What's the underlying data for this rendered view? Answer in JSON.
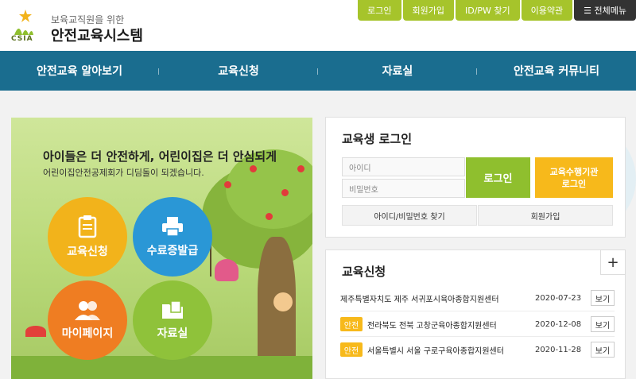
{
  "header": {
    "logo_sub": "보육교직원을 위한",
    "logo_title": "안전교육시스템",
    "logo_abbr": "CSIA"
  },
  "topnav": [
    {
      "label": "로그인"
    },
    {
      "label": "회원가입"
    },
    {
      "label": "ID/PW 찾기"
    },
    {
      "label": "이용약관"
    },
    {
      "label": "☰ 전체메뉴"
    }
  ],
  "mainnav": [
    {
      "label": "안전교육 알아보기"
    },
    {
      "label": "교육신청"
    },
    {
      "label": "자료실"
    },
    {
      "label": "안전교육 커뮤니티"
    }
  ],
  "hero": {
    "title": "아이들은 더 안전하게, 어린이집은 더 안심되게",
    "subtitle": "어린이집안전공제회가 디딤돌이 되겠습니다.",
    "circles": [
      {
        "label": "교육신청",
        "icon": "clipboard-icon"
      },
      {
        "label": "수료증발급",
        "icon": "printer-icon"
      },
      {
        "label": "마이페이지",
        "icon": "people-icon"
      },
      {
        "label": "자료실",
        "icon": "folder-icon"
      }
    ]
  },
  "login": {
    "title": "교육생 로그인",
    "id_placeholder": "아이디",
    "pw_placeholder": "비밀번호",
    "login_button": "로그인",
    "inst_button_line1": "교육수행기관",
    "inst_button_line2": "로그인",
    "find_button": "아이디/비밀번호 찾기",
    "join_button": "회원가입"
  },
  "edu": {
    "title": "교육신청",
    "more": "+",
    "rows": [
      {
        "badge": "",
        "name": "제주특별자치도 제주 서귀포시육아종합지원센터",
        "date": "2020-07-23",
        "view": "보기"
      },
      {
        "badge": "안전",
        "name": "전라북도 전북 고창군육아종합지원센터",
        "date": "2020-12-08",
        "view": "보기"
      },
      {
        "badge": "안전",
        "name": "서울특별시 서울 구로구육아종합지원센터",
        "date": "2020-11-28",
        "view": "보기"
      }
    ]
  },
  "colors": {
    "nav": "#1a6d8f",
    "accent_green": "#8fbf2e",
    "accent_yellow": "#f7b91b"
  }
}
